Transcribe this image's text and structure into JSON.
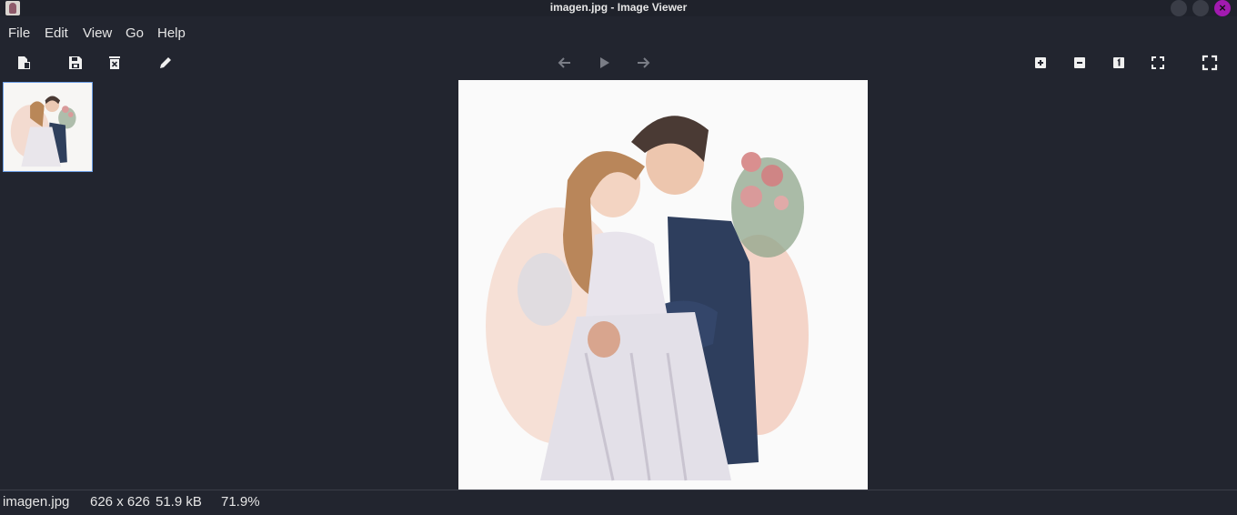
{
  "window": {
    "title": "imagen.jpg - Image Viewer",
    "icon": "app-icon",
    "controls": [
      "minimize-icon",
      "maximize-icon",
      "close-icon"
    ],
    "close_glyph": "×"
  },
  "menu": {
    "file": "File",
    "edit": "Edit",
    "view": "View",
    "go": "Go",
    "help": "Help"
  },
  "toolbar": {
    "left": [
      "open-icon",
      "save-icon",
      "delete-icon",
      "edit-icon"
    ],
    "center": [
      "previous-icon",
      "slideshow-icon",
      "next-icon"
    ],
    "right": [
      "zoom-in-icon",
      "zoom-out-icon",
      "original-size-icon",
      "fit-icon",
      "fullscreen-icon"
    ]
  },
  "status": {
    "filename": "imagen.jpg",
    "dimensions": "626 x 626",
    "filesize": "51.9 kB",
    "zoom": "71.9%"
  },
  "colors": {
    "background": "#22252f",
    "accent": "#a21ab0",
    "thumb_border": "#6ea0e6"
  }
}
